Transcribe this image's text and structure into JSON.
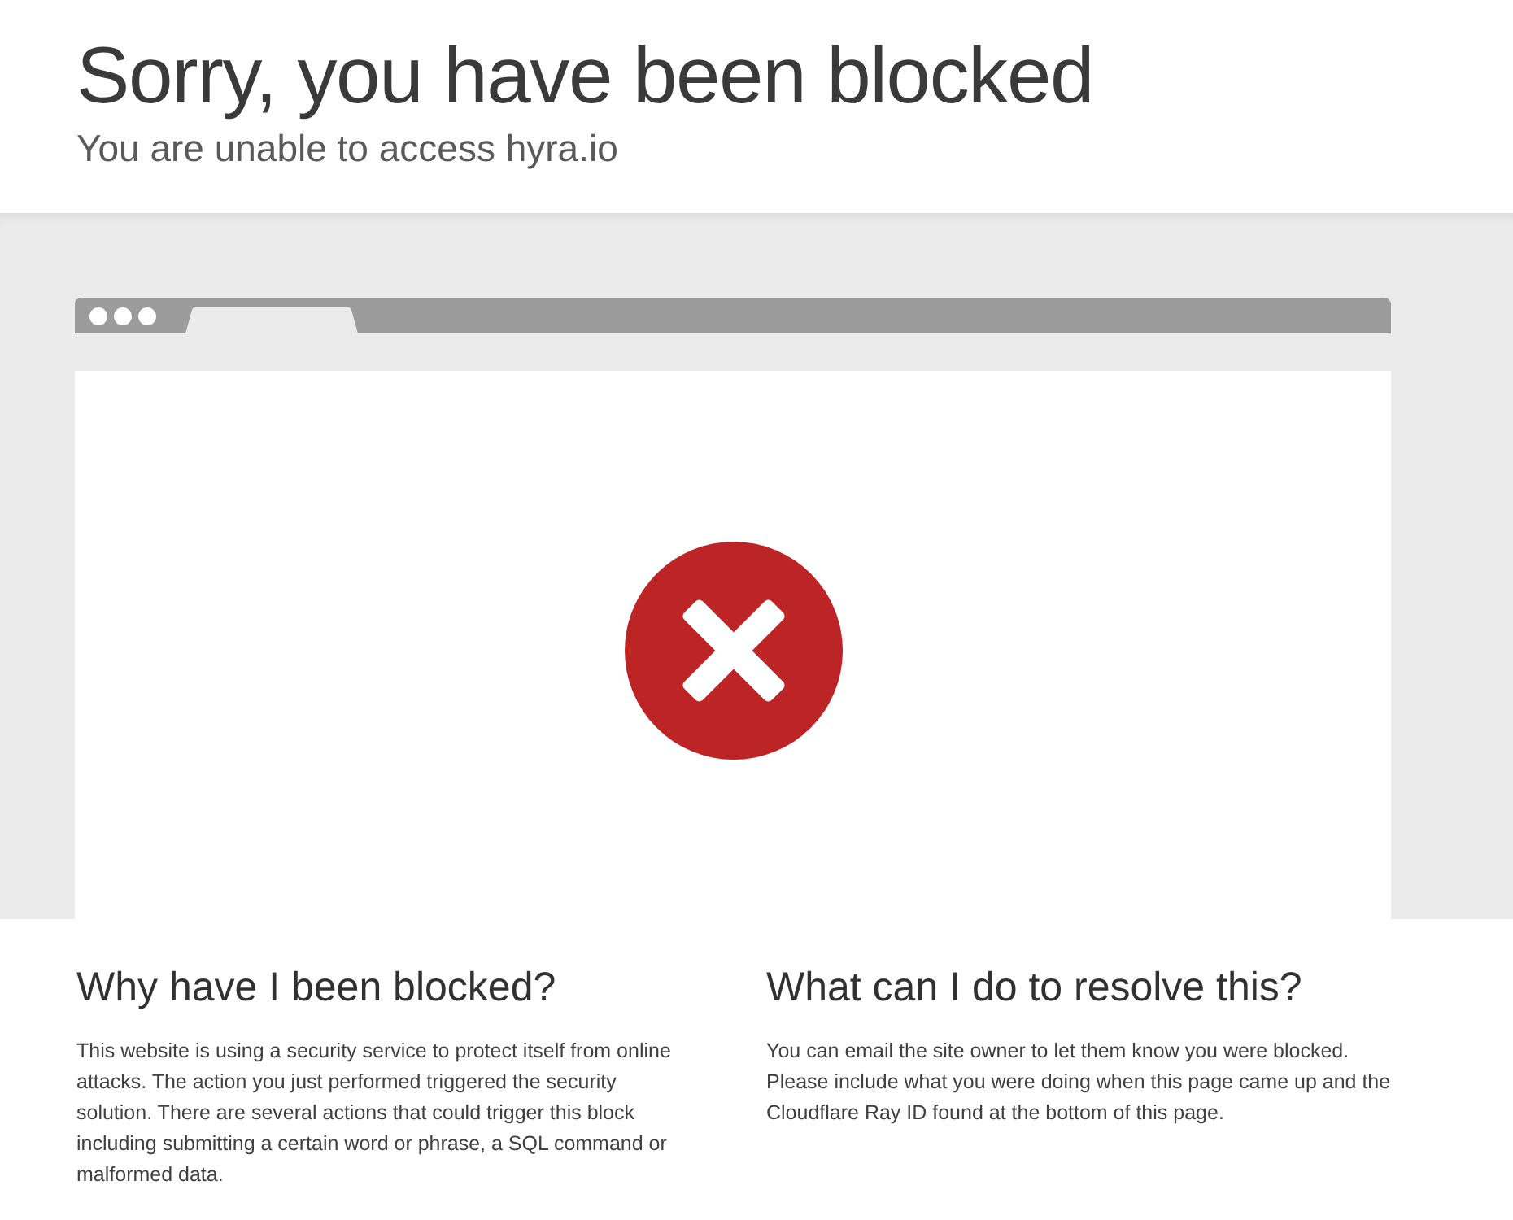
{
  "header": {
    "title": "Sorry, you have been blocked",
    "subtitle": "You are unable to access hyra.io"
  },
  "sections": [
    {
      "heading": "Why have I been blocked?",
      "body": "This website is using a security service to protect itself from online attacks. The action you just performed triggered the security solution. There are several actions that could trigger this block including submitting a certain word or phrase, a SQL command or malformed data."
    },
    {
      "heading": "What can I do to resolve this?",
      "body": "You can email the site owner to let them know you were blocked. Please include what you were doing when this page came up and the Cloudflare Ray ID found at the bottom of this page."
    }
  ]
}
